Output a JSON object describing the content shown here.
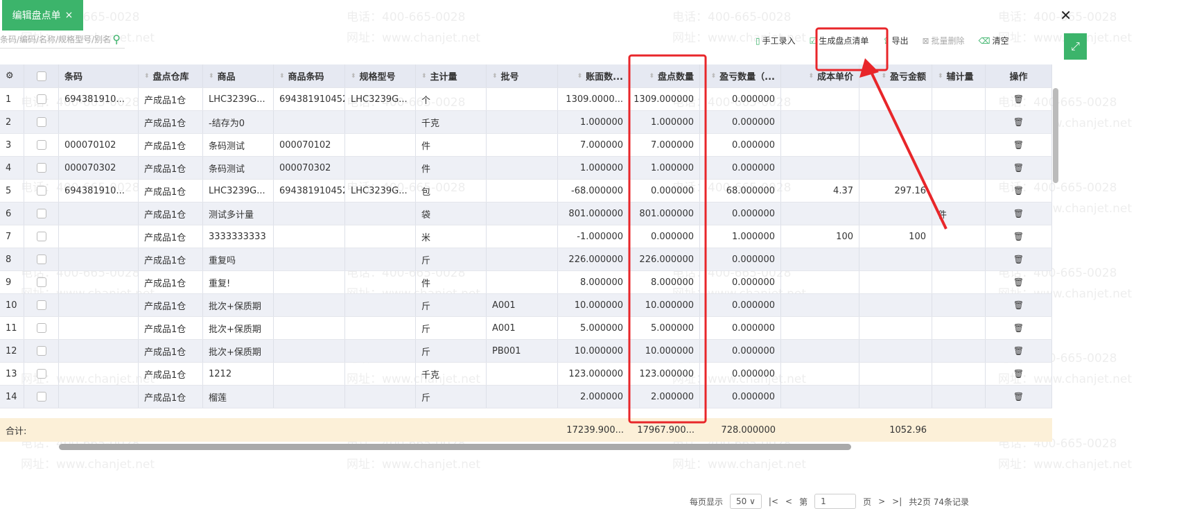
{
  "tab": {
    "title": "编辑盘点单",
    "close": "×"
  },
  "window_close": "✕",
  "search": {
    "placeholder": "条码/编码/名称/规格型号/别名"
  },
  "toolbar": [
    {
      "label": "手工录入",
      "icon": "manual-entry-icon",
      "glyph": "▯",
      "disabled": false
    },
    {
      "label": "生成盘点清单",
      "icon": "clipboard-check-icon",
      "glyph": "☑",
      "disabled": false
    },
    {
      "label": "导出",
      "icon": "export-icon",
      "glyph": "⇪",
      "disabled": false
    },
    {
      "label": "批量删除",
      "icon": "batch-delete-icon",
      "glyph": "⊠",
      "disabled": true
    },
    {
      "label": "清空",
      "icon": "eraser-icon",
      "glyph": "⌫",
      "disabled": false
    }
  ],
  "columns": [
    {
      "key": "idx",
      "label": "⚙",
      "w": 35
    },
    {
      "key": "cb",
      "label": "",
      "w": 50
    },
    {
      "key": "barcode",
      "label": "条码",
      "w": 115
    },
    {
      "key": "wh",
      "label": "盘点仓库",
      "w": 93,
      "sort": true
    },
    {
      "key": "item",
      "label": "商品",
      "w": 102,
      "sort": true
    },
    {
      "key": "itembc",
      "label": "商品条码",
      "w": 103,
      "sort": true
    },
    {
      "key": "spec",
      "label": "规格型号",
      "w": 102,
      "sort": true
    },
    {
      "key": "unit",
      "label": "主计量",
      "w": 102,
      "sort": true
    },
    {
      "key": "batch",
      "label": "批号",
      "w": 103,
      "sort": true
    },
    {
      "key": "book",
      "label": "账面数...",
      "w": 103,
      "sort": true,
      "right": true
    },
    {
      "key": "count",
      "label": "盘点数量",
      "w": 102,
      "sort": true,
      "right": true
    },
    {
      "key": "diff",
      "label": "盈亏数量（...",
      "w": 117,
      "sort": true,
      "right": true
    },
    {
      "key": "cost",
      "label": "成本单价",
      "w": 113,
      "sort": true,
      "right": true
    },
    {
      "key": "amt",
      "label": "盈亏金额",
      "w": 105,
      "sort": true,
      "right": true
    },
    {
      "key": "aux",
      "label": "辅计量",
      "w": 77,
      "sort": true
    },
    {
      "key": "op",
      "label": "操作",
      "w": 96
    }
  ],
  "rows": [
    {
      "idx": "1",
      "barcode": "694381910...",
      "wh": "产成品1仓",
      "item": "LHC3239G...",
      "itembc": "694381910452",
      "spec": "LHC3239G...",
      "unit": "个",
      "batch": "",
      "book": "1309.0000...",
      "count": "1309.000000",
      "diff": "0.000000",
      "cost": "",
      "amt": "",
      "aux": ""
    },
    {
      "idx": "2",
      "barcode": "",
      "wh": "产成品1仓",
      "item": "-结存为0",
      "itembc": "",
      "spec": "",
      "unit": "千克",
      "batch": "",
      "book": "1.000000",
      "count": "1.000000",
      "diff": "0.000000",
      "cost": "",
      "amt": "",
      "aux": ""
    },
    {
      "idx": "3",
      "barcode": "000070102",
      "wh": "产成品1仓",
      "item": "条码测试",
      "itembc": "000070102",
      "spec": "",
      "unit": "件",
      "batch": "",
      "book": "7.000000",
      "count": "7.000000",
      "diff": "0.000000",
      "cost": "",
      "amt": "",
      "aux": ""
    },
    {
      "idx": "4",
      "barcode": "000070302",
      "wh": "产成品1仓",
      "item": "条码测试",
      "itembc": "000070302",
      "spec": "",
      "unit": "件",
      "batch": "",
      "book": "1.000000",
      "count": "1.000000",
      "diff": "0.000000",
      "cost": "",
      "amt": "",
      "aux": ""
    },
    {
      "idx": "5",
      "barcode": "694381910...",
      "wh": "产成品1仓",
      "item": "LHC3239G...",
      "itembc": "694381910452",
      "spec": "LHC3239G...",
      "unit": "包",
      "batch": "",
      "book": "-68.000000",
      "count": "0.000000",
      "diff": "68.000000",
      "cost": "4.37",
      "amt": "297.16",
      "aux": ""
    },
    {
      "idx": "6",
      "barcode": "",
      "wh": "产成品1仓",
      "item": "测试多计量",
      "itembc": "",
      "spec": "",
      "unit": "袋",
      "batch": "",
      "book": "801.000000",
      "count": "801.000000",
      "diff": "0.000000",
      "cost": "",
      "amt": "",
      "aux": "件"
    },
    {
      "idx": "7",
      "barcode": "",
      "wh": "产成品1仓",
      "item": "3333333333",
      "itembc": "",
      "spec": "",
      "unit": "米",
      "batch": "",
      "book": "-1.000000",
      "count": "0.000000",
      "diff": "1.000000",
      "cost": "100",
      "amt": "100",
      "aux": ""
    },
    {
      "idx": "8",
      "barcode": "",
      "wh": "产成品1仓",
      "item": "重复吗",
      "itembc": "",
      "spec": "",
      "unit": "斤",
      "batch": "",
      "book": "226.000000",
      "count": "226.000000",
      "diff": "0.000000",
      "cost": "",
      "amt": "",
      "aux": ""
    },
    {
      "idx": "9",
      "barcode": "",
      "wh": "产成品1仓",
      "item": "重复!",
      "itembc": "",
      "spec": "",
      "unit": "件",
      "batch": "",
      "book": "8.000000",
      "count": "8.000000",
      "diff": "0.000000",
      "cost": "",
      "amt": "",
      "aux": ""
    },
    {
      "idx": "10",
      "barcode": "",
      "wh": "产成品1仓",
      "item": "批次+保质期",
      "itembc": "",
      "spec": "",
      "unit": "斤",
      "batch": "A001",
      "book": "10.000000",
      "count": "10.000000",
      "diff": "0.000000",
      "cost": "",
      "amt": "",
      "aux": ""
    },
    {
      "idx": "11",
      "barcode": "",
      "wh": "产成品1仓",
      "item": "批次+保质期",
      "itembc": "",
      "spec": "",
      "unit": "斤",
      "batch": "A001",
      "book": "5.000000",
      "count": "5.000000",
      "diff": "0.000000",
      "cost": "",
      "amt": "",
      "aux": ""
    },
    {
      "idx": "12",
      "barcode": "",
      "wh": "产成品1仓",
      "item": "批次+保质期",
      "itembc": "",
      "spec": "",
      "unit": "斤",
      "batch": "PB001",
      "book": "10.000000",
      "count": "10.000000",
      "diff": "0.000000",
      "cost": "",
      "amt": "",
      "aux": ""
    },
    {
      "idx": "13",
      "barcode": "",
      "wh": "产成品1仓",
      "item": "1212",
      "itembc": "",
      "spec": "",
      "unit": "千克",
      "batch": "",
      "book": "123.000000",
      "count": "123.000000",
      "diff": "0.000000",
      "cost": "",
      "amt": "",
      "aux": ""
    },
    {
      "idx": "14",
      "barcode": "",
      "wh": "产成品1仓",
      "item": "榴莲",
      "itembc": "",
      "spec": "",
      "unit": "斤",
      "batch": "",
      "book": "2.000000",
      "count": "2.000000",
      "diff": "0.000000",
      "cost": "",
      "amt": "",
      "aux": ""
    }
  ],
  "summary": {
    "label": "合计:",
    "book": "17239.900...",
    "count": "17967.900...",
    "diff": "728.000000",
    "amt": "1052.96"
  },
  "pager": {
    "per_page_label": "每页显示",
    "per_page": "50",
    "page_prefix": "第",
    "page": "1",
    "page_suffix": "页",
    "total": "共2页 74条记录"
  },
  "watermark": {
    "phone": "电话：400-665-0028",
    "site": "网址：www.chanjet.net"
  },
  "annotation_color": "#e8262a"
}
